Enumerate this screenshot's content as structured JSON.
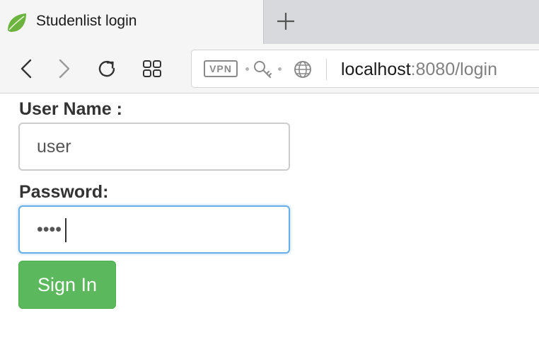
{
  "browser": {
    "tab_title": "Studenlist login",
    "url_badge": "VPN",
    "url_host": "localhost",
    "url_rest": ":8080/login",
    "icons": [
      "spring-leaf-icon",
      "plus-icon",
      "back-icon",
      "forward-icon",
      "reload-icon",
      "grid-icon",
      "key-icon",
      "globe-icon"
    ]
  },
  "form": {
    "username_label": "User Name :",
    "username_value": "user",
    "password_label": "Password:",
    "password_value": "••••",
    "submit_label": "Sign In"
  },
  "colors": {
    "submit": "#5cb85c",
    "focus_border": "#66afe9",
    "tab_active": "#f5f5f5",
    "tab_strip": "#d7d9dc"
  }
}
